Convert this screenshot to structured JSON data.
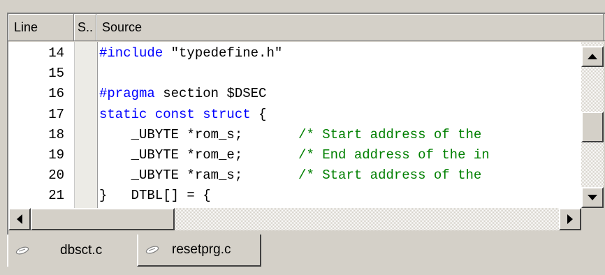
{
  "columns": {
    "line": "Line",
    "status": "S..",
    "source": "Source"
  },
  "rows": [
    {
      "line": "14",
      "tokens": [
        {
          "t": "#include",
          "c": "kw"
        },
        {
          "t": " \"typedefine.h\"",
          "c": "tx"
        }
      ]
    },
    {
      "line": "15",
      "tokens": []
    },
    {
      "line": "16",
      "tokens": [
        {
          "t": "#pragma",
          "c": "kw"
        },
        {
          "t": " section $DSEC",
          "c": "tx"
        }
      ]
    },
    {
      "line": "17",
      "tokens": [
        {
          "t": "static const struct",
          "c": "kw"
        },
        {
          "t": " {",
          "c": "tx"
        }
      ]
    },
    {
      "line": "18",
      "tokens": [
        {
          "t": "    _UBYTE *rom_s;       ",
          "c": "tx"
        },
        {
          "t": "/* Start address of the ",
          "c": "cm"
        }
      ]
    },
    {
      "line": "19",
      "tokens": [
        {
          "t": "    _UBYTE *rom_e;       ",
          "c": "tx"
        },
        {
          "t": "/* End address of the in",
          "c": "cm"
        }
      ]
    },
    {
      "line": "20",
      "tokens": [
        {
          "t": "    _UBYTE *ram_s;       ",
          "c": "tx"
        },
        {
          "t": "/* Start address of the ",
          "c": "cm"
        }
      ]
    },
    {
      "line": "21",
      "tokens": [
        {
          "t": "}   DTBL[] = {",
          "c": "tx"
        }
      ]
    }
  ],
  "tabs": [
    {
      "label": "dbsct.c",
      "icon": "file-icon",
      "active": true
    },
    {
      "label": "resetprg.c",
      "icon": "file-icon",
      "active": false
    }
  ],
  "colors": {
    "keyword": "#0000ff",
    "comment": "#008000",
    "text": "#000000"
  }
}
